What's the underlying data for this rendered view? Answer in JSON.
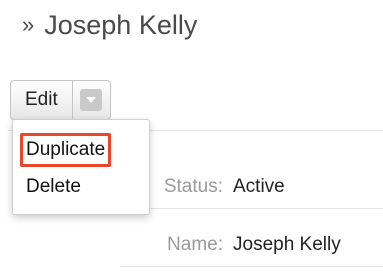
{
  "header": {
    "chevron": "»",
    "record_name": "Joseph Kelly"
  },
  "actions": {
    "edit_label": "Edit",
    "caret_icon": "chevron-down-icon"
  },
  "dropdown": {
    "items": [
      {
        "label": "Duplicate",
        "highlighted": true
      },
      {
        "label": "Delete",
        "highlighted": false
      }
    ]
  },
  "details": {
    "rows": [
      {
        "label": "Status:",
        "value": "Active"
      },
      {
        "label": "Name:",
        "value": "Joseph Kelly"
      }
    ]
  },
  "colors": {
    "highlight_border": "#e8472b",
    "label_gray": "#9a9a9a"
  }
}
